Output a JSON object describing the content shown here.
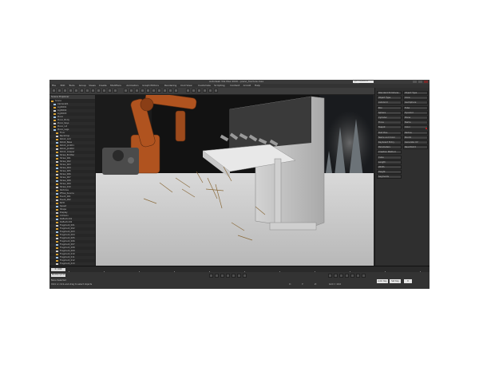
{
  "app": {
    "title": "Autodesk 3ds Max 2020 - piano_fracture.max",
    "search_placeholder": "Type a keyword or phrase"
  },
  "menu": [
    "File",
    "Edit",
    "Tools",
    "Group",
    "Views",
    "Create",
    "Modifiers",
    "Animation",
    "Graph Editors",
    "Rendering",
    "Civil View",
    "Customize",
    "Scripting",
    "Content",
    "Arnold",
    "Help"
  ],
  "explorer": {
    "header": "Scene Explorer",
    "items": [
      "Scene",
      "Camera01",
      "Light001",
      "Light002",
      "Light003",
      "Piano",
      "Piano_Body",
      "Piano_Keys",
      "Piano_Lid",
      "Piano_Legs",
      "Floor",
      "Backdrop",
      "Robot_Arm",
      "Robot_Base",
      "Robot_Joint01",
      "Robot_Joint02",
      "Robot_Gripper",
      "Straw_Emitter",
      "Straw_001",
      "Straw_002",
      "Straw_003",
      "Straw_004",
      "Straw_005",
      "Straw_006",
      "Straw_007",
      "Straw_008",
      "Straw_009",
      "Straw_010",
      "Particles",
      "PFlow_Source",
      "Event_001",
      "Event_002",
      "Birth",
      "Speed",
      "Shape",
      "Display",
      "Collision",
      "Deflector01",
      "Deflector02",
      "Fragment_001",
      "Fragment_002",
      "Fragment_003",
      "Fragment_004",
      "Fragment_005",
      "Fragment_006",
      "Fragment_007",
      "Fragment_008",
      "Fragment_009",
      "Fragment_010",
      "Fragment_011",
      "Fragment_012",
      "Fragment_013"
    ]
  },
  "command_panel": {
    "left_labels": [
      "Standard Primitives",
      "Object Type",
      "AutoGrid",
      "Box",
      "Sphere",
      "Cylinder",
      "Torus",
      "Teapot",
      "Text Plus",
      "Name and Color",
      "Keyboard Entry",
      "Parameters",
      "Creation Method",
      "Cube",
      "Length",
      "Width",
      "Height",
      "Segments"
    ],
    "right_labels": [
      "Object Type",
      "Cone",
      "GeoSphere",
      "Tube",
      "Pyramid",
      "Plane",
      "Name",
      "Color",
      "Radius",
      "Box01",
      "Generate UV",
      "Real-World"
    ]
  },
  "timeline": {
    "frame_label": "0 / 100",
    "ticks": [
      "0",
      "10",
      "20",
      "30",
      "40",
      "50",
      "60",
      "70",
      "80",
      "90",
      "100"
    ]
  },
  "status": {
    "maxscript": "MAXScript Mi",
    "selection": "None Selected",
    "hint": "Click or click-and-drag to select objects",
    "x": "X:",
    "y": "Y:",
    "z": "Z:",
    "grid": "Grid = 10.0",
    "auto_key": "Auto Key",
    "set_key": "Set Key",
    "frame": "0"
  }
}
